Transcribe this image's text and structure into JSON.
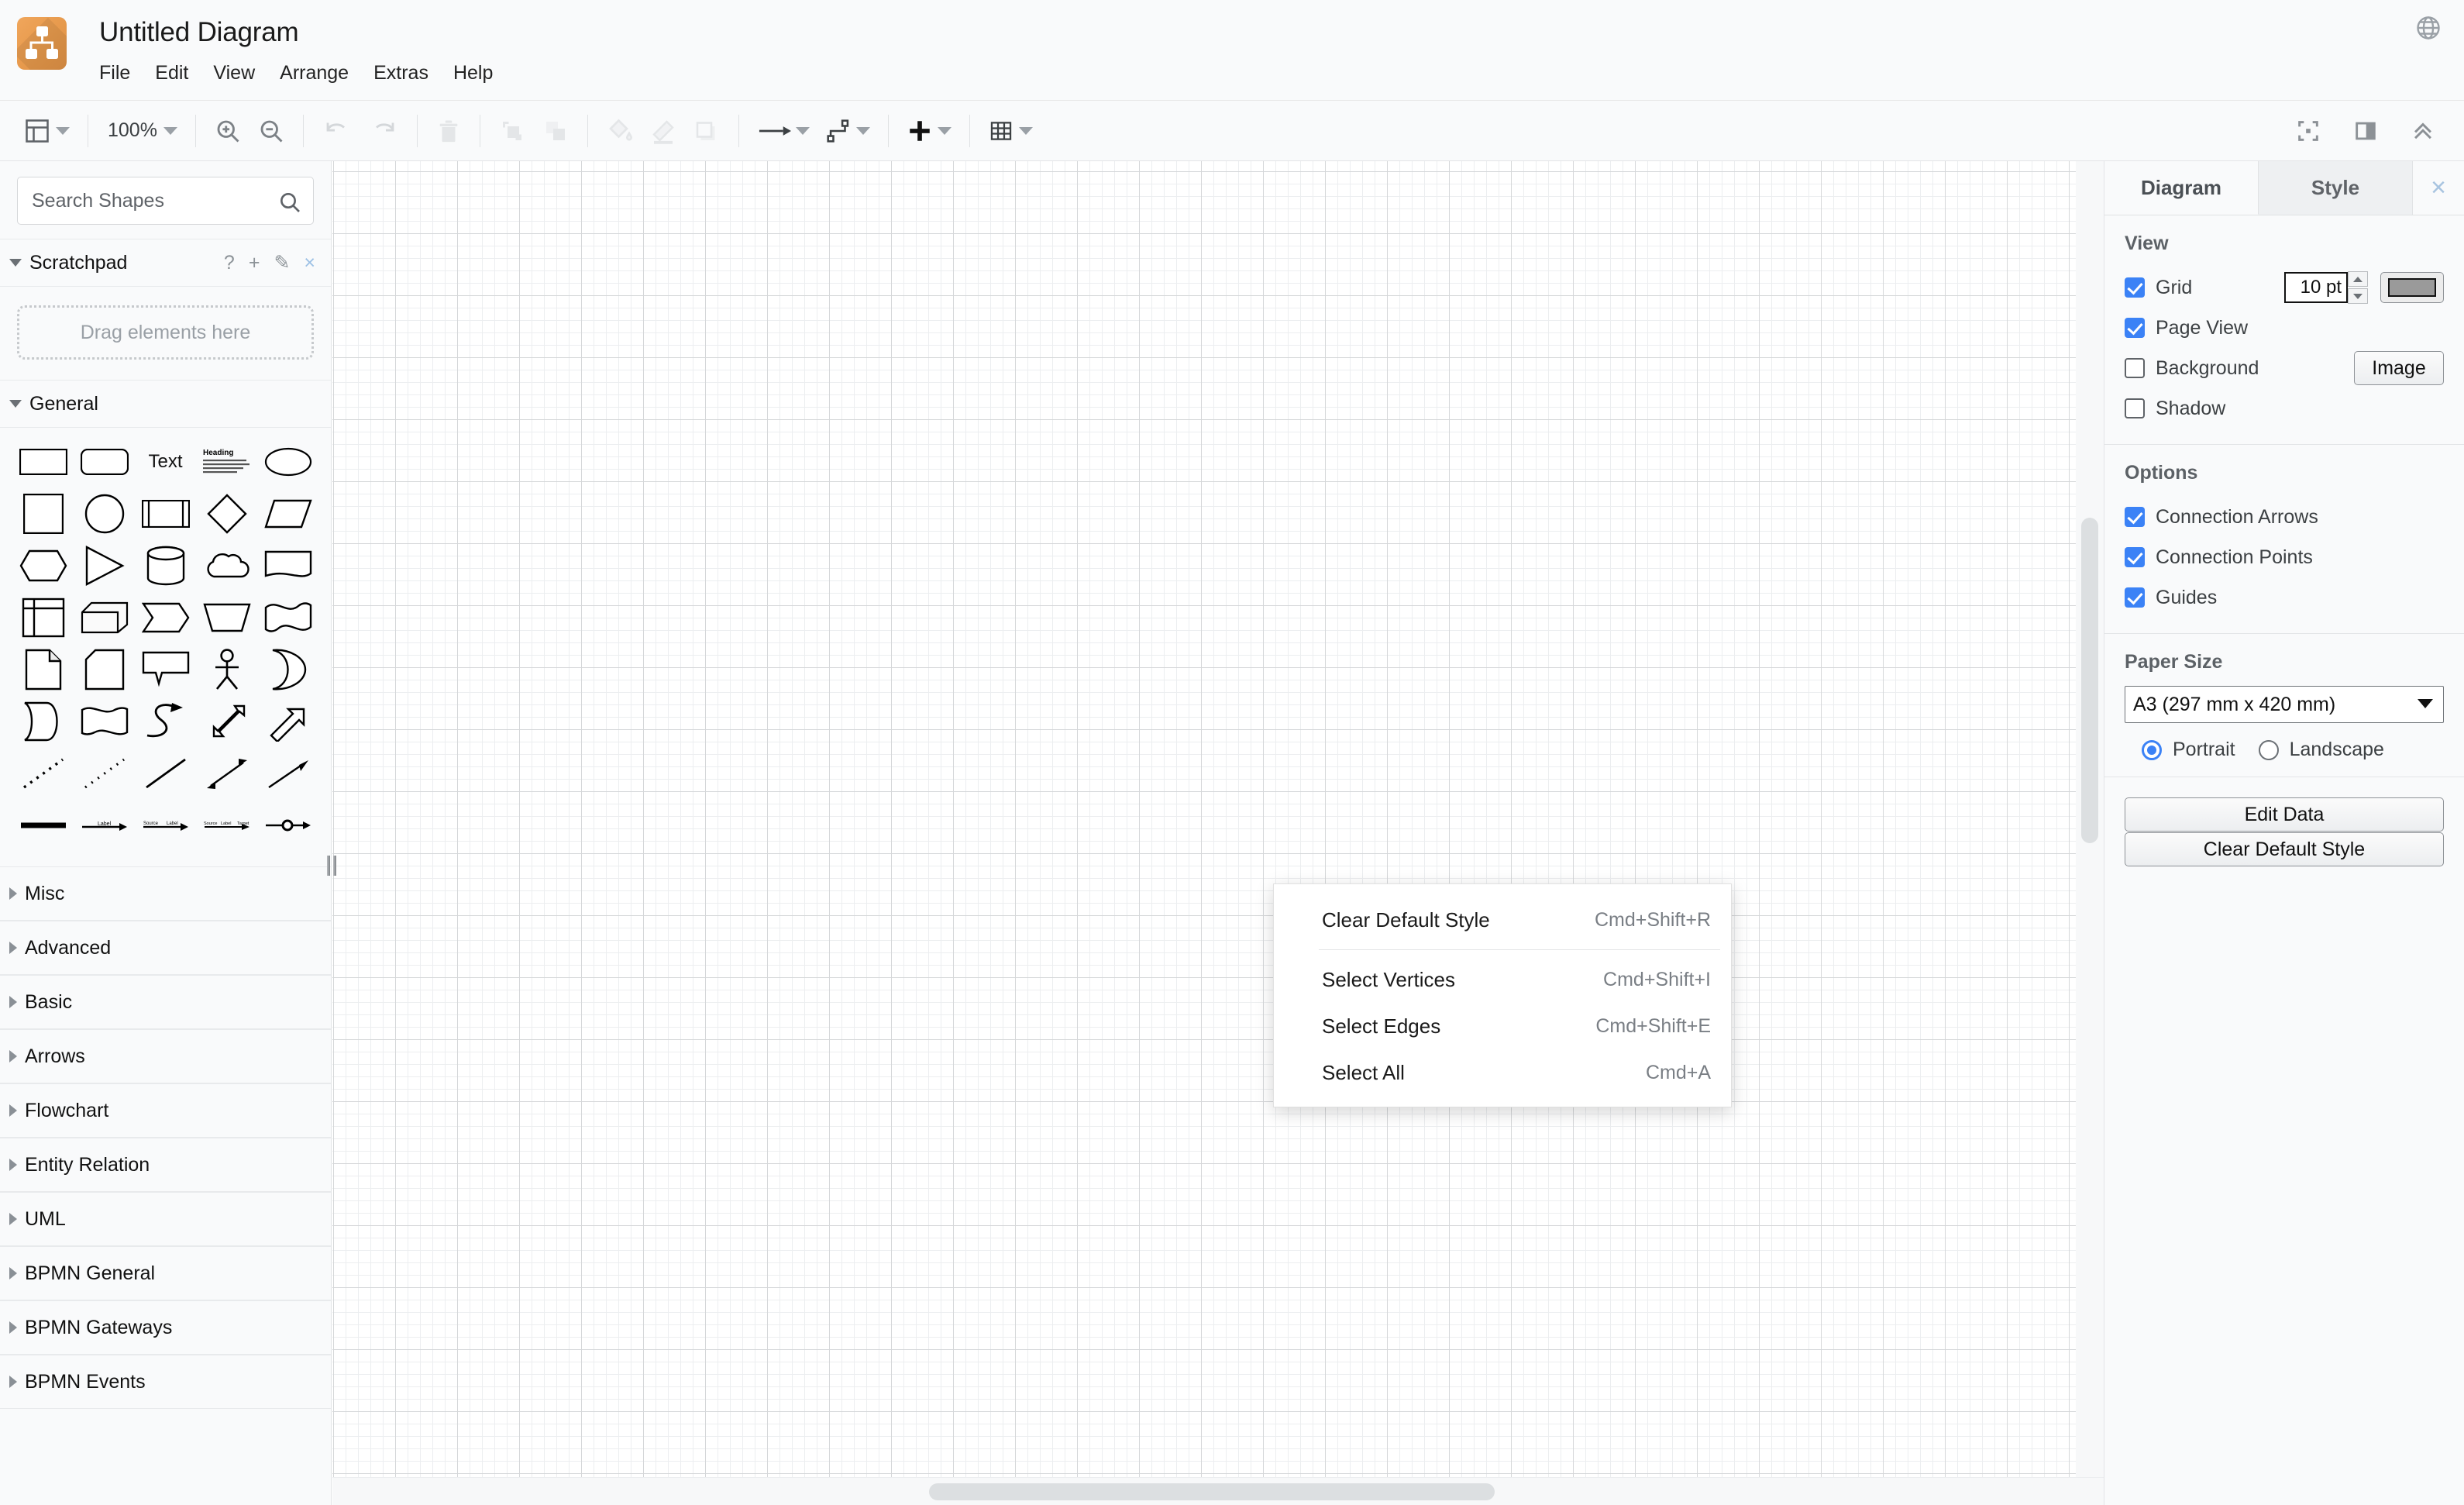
{
  "header": {
    "logo_icon": "diagram-tree-icon",
    "title": "Untitled Diagram",
    "menus": [
      "File",
      "Edit",
      "View",
      "Arrange",
      "Extras",
      "Help"
    ],
    "globe_icon": "globe-language-icon"
  },
  "toolbar": {
    "view_layout_icon": "layout-panes-icon",
    "zoom_level": "100%",
    "zoom_in_icon": "zoom-in-icon",
    "zoom_out_icon": "zoom-out-icon",
    "undo_icon": "undo-icon",
    "redo_icon": "redo-icon",
    "delete_icon": "trash-icon",
    "to_front_icon": "bring-to-front-icon",
    "to_back_icon": "send-to-back-icon",
    "fill_color_icon": "paint-bucket-icon",
    "line_color_icon": "pen-icon",
    "shadow_icon": "shadow-square-icon",
    "waypoints_icon": "straight-arrow-icon",
    "connection_icon": "elbow-connector-icon",
    "insert_icon": "plus-icon",
    "table_icon": "table-grid-icon",
    "fullscreen_icon": "fit-page-icon",
    "format_panel_icon": "toggle-format-panel-icon",
    "collapse_icon": "chevron-double-up-icon"
  },
  "sidebar": {
    "search": {
      "placeholder": "Search Shapes",
      "value": "",
      "icon": "search-icon"
    },
    "scratchpad": {
      "title": "Scratchpad",
      "help_icon": "?",
      "add_icon": "+",
      "edit_icon": "✎",
      "close_icon": "×",
      "drop_hint": "Drag elements here"
    },
    "general": {
      "title": "General",
      "shapes": [
        "rectangle",
        "rounded-rectangle",
        "text",
        "textbox-heading",
        "ellipse",
        "square",
        "circle",
        "process",
        "diamond",
        "parallelogram",
        "hexagon",
        "triangle",
        "cylinder",
        "cloud",
        "document",
        "internal-storage",
        "cube",
        "step",
        "trapezoid",
        "tape",
        "note",
        "card",
        "callout",
        "actor",
        "or-shape",
        "data-storage",
        "delay",
        "curve-arrow",
        "double-arrow",
        "single-arrow",
        "dashed-line-1",
        "dashed-line-2",
        "plain-line",
        "bidirectional-arrow",
        "directional-arrow",
        "thick-line",
        "labeled-arrow",
        "source-label-arrow",
        "source-label-target-arrow",
        "circle-connector"
      ]
    },
    "categories": [
      "Misc",
      "Advanced",
      "Basic",
      "Arrows",
      "Flowchart",
      "Entity Relation",
      "UML",
      "BPMN General",
      "BPMN Gateways",
      "BPMN Events"
    ]
  },
  "canvas": {
    "grid_visible": true,
    "h_scrollbar": true,
    "v_scrollbar": true,
    "splitter_icon": "resize-handle-icon"
  },
  "context_menu": {
    "items": [
      {
        "label": "Clear Default Style",
        "shortcut": "Cmd+Shift+R"
      },
      {
        "label": "Select Vertices",
        "shortcut": "Cmd+Shift+I"
      },
      {
        "label": "Select Edges",
        "shortcut": "Cmd+Shift+E"
      },
      {
        "label": "Select All",
        "shortcut": "Cmd+A"
      }
    ]
  },
  "format_panel": {
    "tabs": [
      {
        "label": "Diagram",
        "active": true
      },
      {
        "label": "Style",
        "active": false
      }
    ],
    "close_icon": "×",
    "view": {
      "heading": "View",
      "grid": {
        "label": "Grid",
        "checked": true,
        "size": "10 pt",
        "color": "#9a9a9a"
      },
      "page_view": {
        "label": "Page View",
        "checked": true
      },
      "background": {
        "label": "Background",
        "checked": false,
        "button": "Image"
      },
      "shadow": {
        "label": "Shadow",
        "checked": false
      }
    },
    "options": {
      "heading": "Options",
      "items": [
        {
          "label": "Connection Arrows",
          "checked": true
        },
        {
          "label": "Connection Points",
          "checked": true
        },
        {
          "label": "Guides",
          "checked": true
        }
      ]
    },
    "paper": {
      "heading": "Paper Size",
      "selected": "A3 (297 mm x 420 mm)",
      "orientation": [
        {
          "label": "Portrait",
          "selected": true
        },
        {
          "label": "Landscape",
          "selected": false
        }
      ]
    },
    "buttons": [
      {
        "label": "Edit Data"
      },
      {
        "label": "Clear Default Style"
      }
    ],
    "accent_color": "#3b82f6"
  }
}
